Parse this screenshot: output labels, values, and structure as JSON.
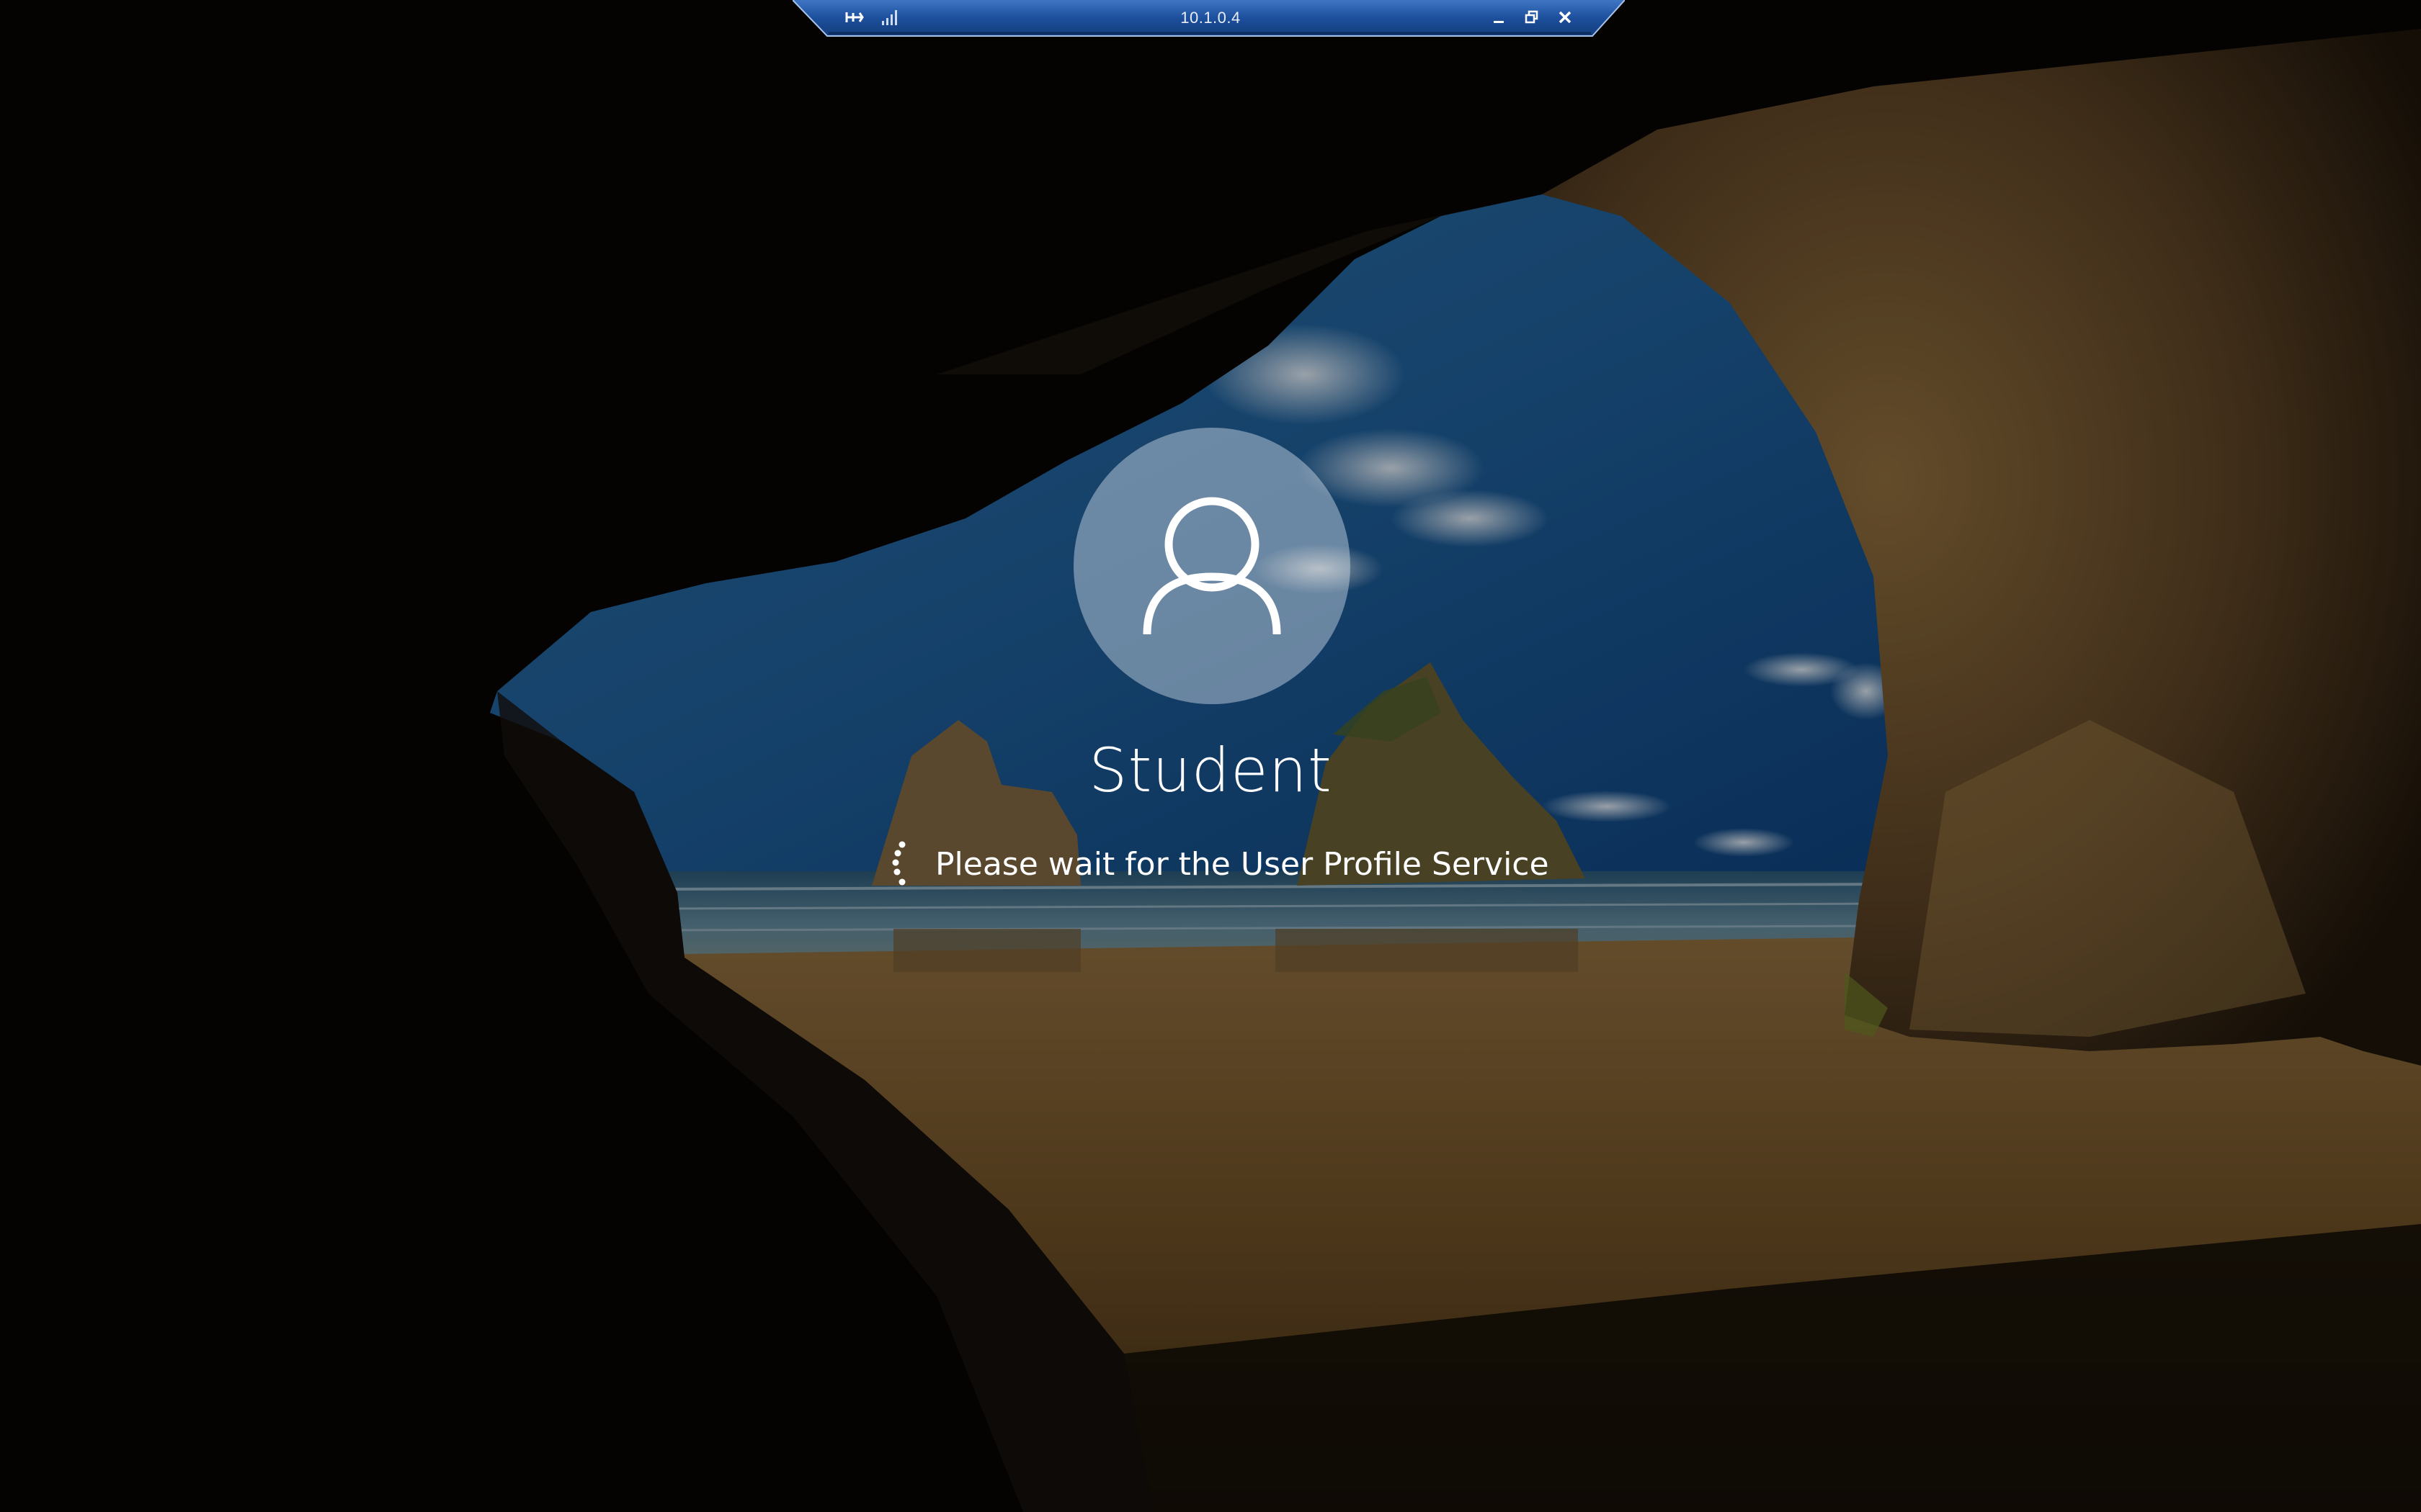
{
  "rdp_bar": {
    "title": "10.1.0.4",
    "pin_icon": "pin-icon",
    "signal_icon": "connection-quality-icon",
    "minimize_icon": "minimize-icon",
    "restore_icon": "restore-icon",
    "close_icon": "close-icon",
    "accent_color": "#1c4f9c"
  },
  "login": {
    "user_name": "Student",
    "avatar_icon": "user-avatar-icon",
    "spinner_icon": "loading-spinner-icon",
    "status_message": "Please wait for the User Profile Service"
  },
  "background": {
    "description_icon": "cave-beach-wallpaper"
  }
}
